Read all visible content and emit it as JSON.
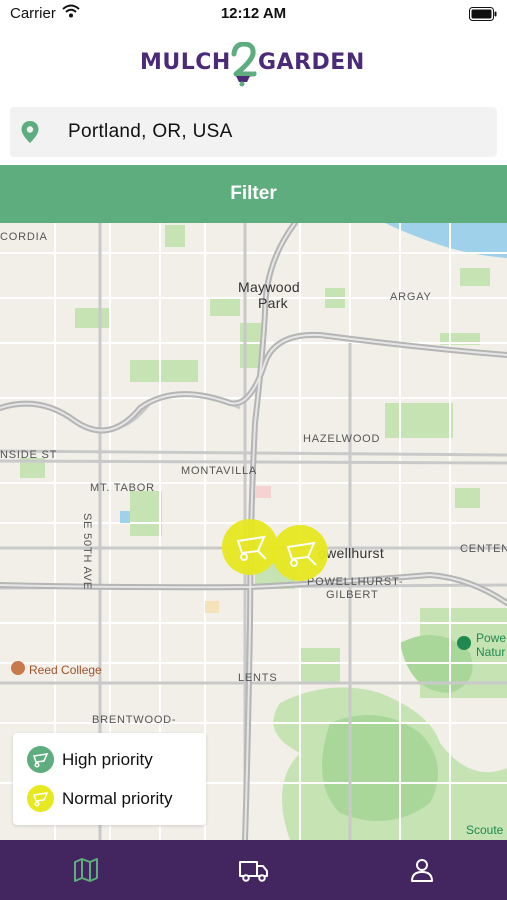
{
  "status_bar": {
    "carrier": "Carrier",
    "time": "12:12 AM"
  },
  "logo": {
    "part1": "MULCH",
    "part2": "2",
    "part3": "GARDEN"
  },
  "search": {
    "value": "Portland, OR, USA",
    "icon": "location-pin-icon"
  },
  "filter": {
    "label": "Filter"
  },
  "map": {
    "labels": {
      "concordia": "CORDIA",
      "maywood_1": "Maywood",
      "maywood_2": "Park",
      "argay": "ARGAY",
      "hazelwood": "HAZELWOOD",
      "inside": "NSIDE ST",
      "montavilla": "MONTAVILLA",
      "mt_tabor": "MT. TABOR",
      "se_50th": "SE 50TH AVE",
      "powellhurst": "owellhurst",
      "centennial": "CENTENN",
      "powellhurst_gilbert_1": "POWELLHURST-",
      "powellhurst_gilbert_2": "GILBERT",
      "powell_butte_1": "Powe",
      "powell_butte_2": "Natur",
      "reed": "Reed College",
      "lents": "LENTS",
      "brentwood": "BRENTWOOD-",
      "scouter": "Scoute"
    },
    "markers": [
      {
        "priority": "normal",
        "icon": "wheelbarrow-icon"
      },
      {
        "priority": "normal",
        "icon": "wheelbarrow-icon"
      }
    ]
  },
  "legend": {
    "high": {
      "label": "High priority",
      "color": "#5ead7e"
    },
    "normal": {
      "label": "Normal priority",
      "color": "#e8e820"
    }
  },
  "tabs": [
    {
      "name": "map",
      "icon": "map-icon",
      "active": true
    },
    {
      "name": "deliveries",
      "icon": "truck-icon",
      "active": false
    },
    {
      "name": "profile",
      "icon": "user-icon",
      "active": false
    }
  ],
  "colors": {
    "brand": "#4b2a78",
    "accent": "#5ead7e",
    "tabbar": "#432560"
  }
}
